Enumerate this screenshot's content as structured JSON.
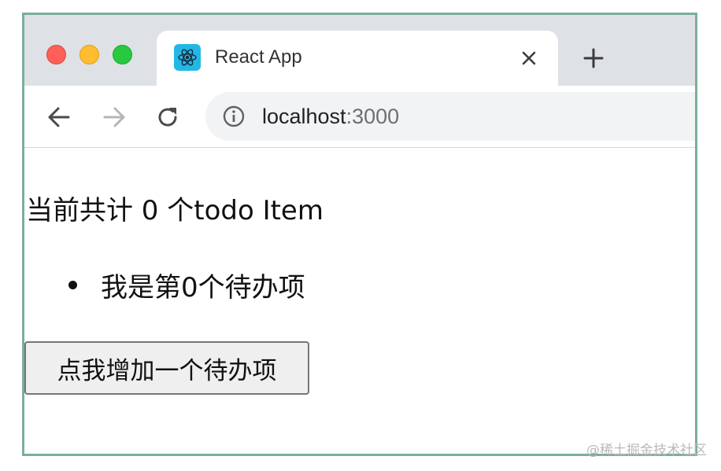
{
  "browser": {
    "tab": {
      "title": "React App",
      "favicon": "react-logo-icon",
      "close_icon": "close-icon"
    },
    "new_tab_icon": "plus-icon",
    "nav": {
      "back_icon": "arrow-left-icon",
      "forward_icon": "arrow-right-icon",
      "reload_icon": "reload-icon"
    },
    "address": {
      "info_icon": "info-icon",
      "host": "localhost",
      "port": ":3000"
    },
    "window_controls": [
      "close",
      "minimize",
      "maximize"
    ]
  },
  "page": {
    "count_text": "当前共计 0 个todo Item",
    "todo_items": [
      "我是第0个待办项"
    ],
    "add_button_label": "点我增加一个待办项"
  },
  "watermark": "@稀土掘金技术社区",
  "colors": {
    "frame_border": "#7aaf98",
    "tabstrip": "#dee1e6",
    "react_blue": "#22b8e6"
  }
}
